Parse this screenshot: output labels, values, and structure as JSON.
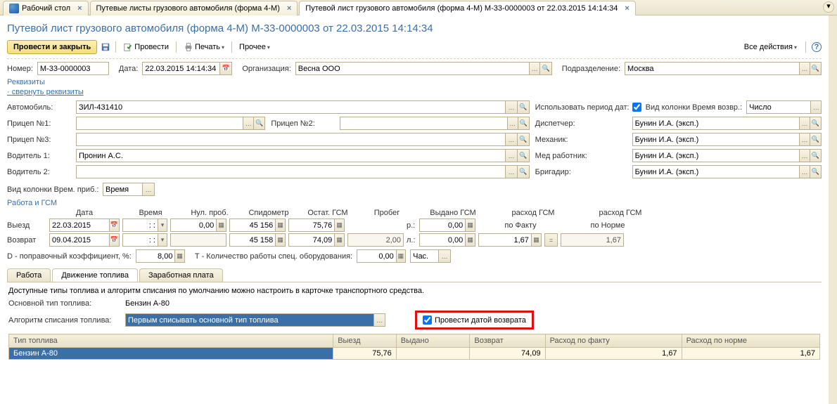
{
  "tabs": {
    "items": [
      {
        "label": "Рабочий стол"
      },
      {
        "label": "Путевые листы грузового автомобиля (форма 4-М)"
      },
      {
        "label": "Путевой лист грузового автомобиля (форма 4-М) М-33-0000003 от 22.03.2015 14:14:34"
      }
    ]
  },
  "title": "Путевой лист грузового автомобиля (форма 4-М) М-33-0000003 от 22.03.2015 14:14:34",
  "toolbar": {
    "post_close": "Провести и закрыть",
    "post": "Провести",
    "print": "Печать",
    "other": "Прочее",
    "all_actions": "Все действия"
  },
  "header": {
    "number_lbl": "Номер:",
    "number": "М-33-0000003",
    "date_lbl": "Дата:",
    "date": "22.03.2015 14:14:34",
    "org_lbl": "Организация:",
    "org": "Весна ООО",
    "dept_lbl": "Подразделение:",
    "dept": "Москва"
  },
  "req": {
    "title": "Реквизиты",
    "collapse": "свернуть реквизиты",
    "auto_lbl": "Автомобиль:",
    "auto": "ЗИЛ-431410",
    "use_period_lbl": "Использовать период дат:",
    "col_return_lbl": "Вид колонки Время возвр.:",
    "col_return": "Число",
    "trailer1_lbl": "Прицеп №1:",
    "trailer2_lbl": "Прицеп №2:",
    "dispatcher_lbl": "Диспетчер:",
    "dispatcher": "Бунин И.А. (эксп.)",
    "trailer3_lbl": "Прицеп №3:",
    "mechanic_lbl": "Механик:",
    "mechanic": "Бунин И.А. (эксп.)",
    "driver1_lbl": "Водитель 1:",
    "driver1": "Пронин А.С.",
    "med_lbl": "Мед работник:",
    "med": "Бунин И.А. (эксп.)",
    "driver2_lbl": "Водитель 2:",
    "brigadir_lbl": "Бригадир:",
    "brigadir": "Бунин И.А. (эксп.)",
    "col_arr_lbl": "Вид колонки Врем. приб.:",
    "col_arr": "Время"
  },
  "wg": {
    "title": "Работа и ГСМ",
    "cols": {
      "date": "Дата",
      "time": "Время",
      "zero": "Нул. проб.",
      "speedo": "Спидометр",
      "remain": "Остат. ГСМ",
      "mileage": "Пробег",
      "issued": "Выдано ГСМ",
      "cons": "расход ГСМ",
      "cons2": "расход ГСМ"
    },
    "depart_lbl": "Выезд",
    "return_lbl": "Возврат",
    "depart": {
      "date": "22.03.2015",
      "time": ": :",
      "zero": "0,00",
      "speedo": "45 156",
      "remain": "75,76",
      "r": "р.:",
      "r_val": "0,00",
      "fact": "по Факту",
      "norm": "по Норме"
    },
    "return": {
      "date": "09.04.2015",
      "time": ": :",
      "zero": "",
      "speedo": "45 158",
      "remain": "74,09",
      "mileage": "2,00",
      "r": "л.:",
      "r_val": "0,00",
      "fact_val": "1,67",
      "eq": "=",
      "norm_val": "1,67"
    },
    "d_lbl": "D - поправочный коэффициент, %:",
    "d_val": "8,00",
    "t_lbl": "Т - Количество работы спец. оборудования:",
    "t_val": "0,00",
    "t_unit": "Час."
  },
  "subtabs": {
    "work": "Работа",
    "fuel": "Движение топлива",
    "salary": "Заработная плата"
  },
  "fuel": {
    "hint": "Доступные типы топлива и алгоритм списания по умолчанию можно настроить в карточке транспортного средства.",
    "main_type_lbl": "Основной тип топлива:",
    "main_type": "Бензин А-80",
    "algo_lbl": "Алгоритм списания топлива:",
    "algo": "Первым списывать основной тип топлива",
    "return_date_cb": "Провести датой возврата",
    "table": {
      "cols": {
        "type": "Тип топлива",
        "depart": "Выезд",
        "issued": "Выдано",
        "return": "Возврат",
        "fact": "Расход по факту",
        "norm": "Расход по норме"
      },
      "row": {
        "type": "Бензин А-80",
        "depart": "75,76",
        "issued": "",
        "return": "74,09",
        "fact": "1,67",
        "norm": "1,67"
      }
    }
  }
}
